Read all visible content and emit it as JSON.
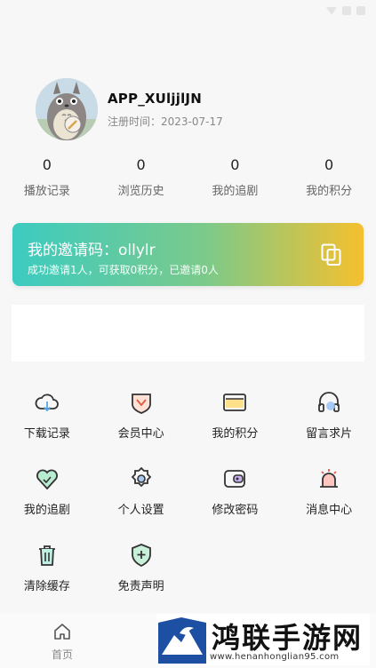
{
  "colors": {
    "background": "#f7f7f7",
    "invite_gradient_start": "#3ccbc1",
    "invite_gradient_mid": "#7cca8a",
    "invite_gradient_end": "#f5c02e"
  },
  "profile": {
    "username": "APP_XUljjlJN",
    "reg_date": "注册时间：2023-07-17",
    "avatar_icon": "totoro-avatar"
  },
  "stats": [
    {
      "value": "0",
      "label": "播放记录"
    },
    {
      "value": "0",
      "label": "浏览历史"
    },
    {
      "value": "0",
      "label": "我的追剧"
    },
    {
      "value": "0",
      "label": "我的积分"
    }
  ],
  "invite": {
    "title": "我的邀请码：ollylr",
    "subtitle": "成功邀请1人，可获取0积分，已邀请0人",
    "icon": "copy-icon"
  },
  "menu": [
    {
      "label": "下载记录",
      "icon": "download-cloud-icon"
    },
    {
      "label": "会员中心",
      "icon": "vip-icon"
    },
    {
      "label": "我的积分",
      "icon": "wallet-card-icon"
    },
    {
      "label": "留言求片",
      "icon": "headset-icon"
    },
    {
      "label": "我的追剧",
      "icon": "heart-icon"
    },
    {
      "label": "个人设置",
      "icon": "gear-icon"
    },
    {
      "label": "修改密码",
      "icon": "password-wallet-icon"
    },
    {
      "label": "消息中心",
      "icon": "alarm-bell-icon"
    },
    {
      "label": "清除缓存",
      "icon": "trash-icon"
    },
    {
      "label": "免责声明",
      "icon": "shield-plus-icon"
    }
  ],
  "bottom_nav": {
    "home_label": "首页",
    "home_icon": "home-icon"
  },
  "watermark": {
    "text": "鸿联手游网",
    "url": "www.henanhonglian95.com"
  }
}
